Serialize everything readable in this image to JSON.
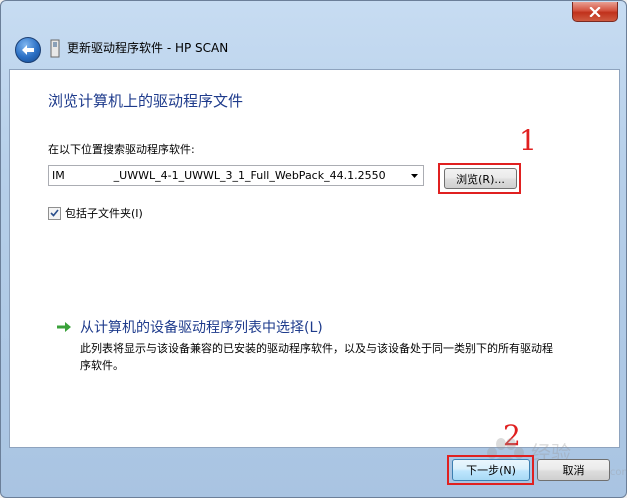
{
  "window": {
    "title": "更新驱动程序软件 - HP SCAN"
  },
  "content": {
    "heading": "浏览计算机上的驱动程序文件",
    "search_label": "在以下位置搜索驱动程序软件:",
    "path_value": "IM              _UWWL_4-1_UWWL_3_1_Full_WebPack_44.1.2550",
    "browse_label": "浏览(R)...",
    "include_subfolders_label": "包括子文件夹(I)",
    "include_subfolders_checked": true,
    "pick_link": "从计算机的设备驱动程序列表中选择(L)",
    "pick_desc": "此列表将显示与该设备兼容的已安装的驱动程序软件，以及与该设备处于同一类别下的所有驱动程序软件。"
  },
  "footer": {
    "next_label": "下一步(N)",
    "cancel_label": "取消"
  },
  "annotations": {
    "step1": "1",
    "step2": "2",
    "color": "#e02020"
  },
  "watermark": {
    "text": "经验",
    "sub": "jingyan.baidu.com"
  },
  "icons": {
    "back": "back-arrow-icon",
    "device": "device-icon",
    "close": "close-icon",
    "link": "green-arrow-icon",
    "dropdown": "chevron-down-icon",
    "checkbox": "checkmark-icon"
  }
}
